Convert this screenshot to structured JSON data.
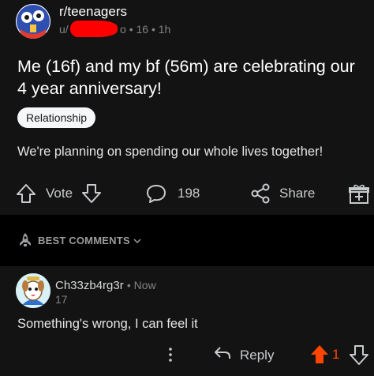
{
  "post": {
    "subreddit": "r/teenagers",
    "author_prefix": "u/",
    "author_suffix": "o",
    "meta_rest": "• 16 • 1h",
    "title": "Me (16f) and my bf (56m) are celebrating our 4 year anniversary!",
    "flair": "Relationship",
    "body": "We're planning on spending our whole lives together!",
    "vote_label": "Vote",
    "comment_count": "198",
    "share_label": "Share"
  },
  "sort": {
    "label": "BEST COMMENTS"
  },
  "comment": {
    "username": "Ch33zb4rg3r",
    "age": "• Now",
    "score_line": "17",
    "body": "Something's wrong, I can feel it",
    "reply_label": "Reply",
    "vote_count": "1"
  },
  "colors": {
    "upvote_active": "#ff4500",
    "redaction": "#ff0000",
    "flair_bg": "#f6f7f8"
  },
  "icons": [
    "upvote-icon",
    "downvote-icon",
    "comment-icon",
    "share-icon",
    "award-icon",
    "rocket-icon",
    "chevron-down-icon",
    "more-icon",
    "reply-icon"
  ]
}
